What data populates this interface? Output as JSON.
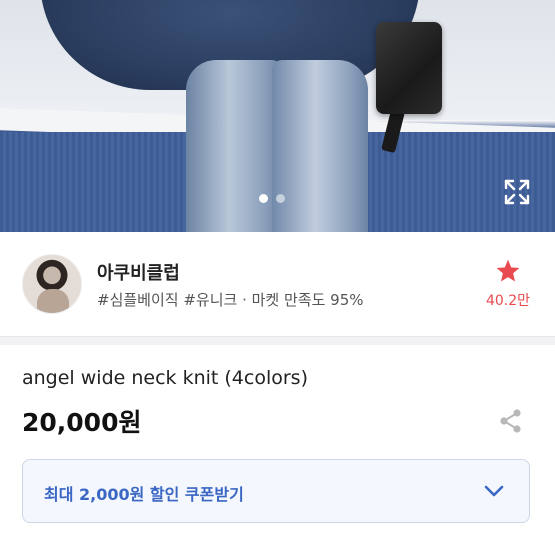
{
  "hero": {
    "image_description_icon": "product-photo",
    "carousel": {
      "total": 2,
      "active_index": 0
    },
    "expand_icon": "expand-icon"
  },
  "seller": {
    "name": "아쿠비클럽",
    "tags": "#심플베이직 #유니크 · 마켓 만족도 95%",
    "favorite_count": "40.2만",
    "favorite_icon": "star-icon",
    "favorite_color": "#e94a4f"
  },
  "product": {
    "title": "angel wide neck knit (4colors)",
    "price": "20,000원",
    "share_icon": "share-icon"
  },
  "coupon": {
    "label": "최대 2,000원 할인 쿠폰받기",
    "accent_color": "#3a66c4",
    "chevron_icon": "chevron-down-icon"
  }
}
